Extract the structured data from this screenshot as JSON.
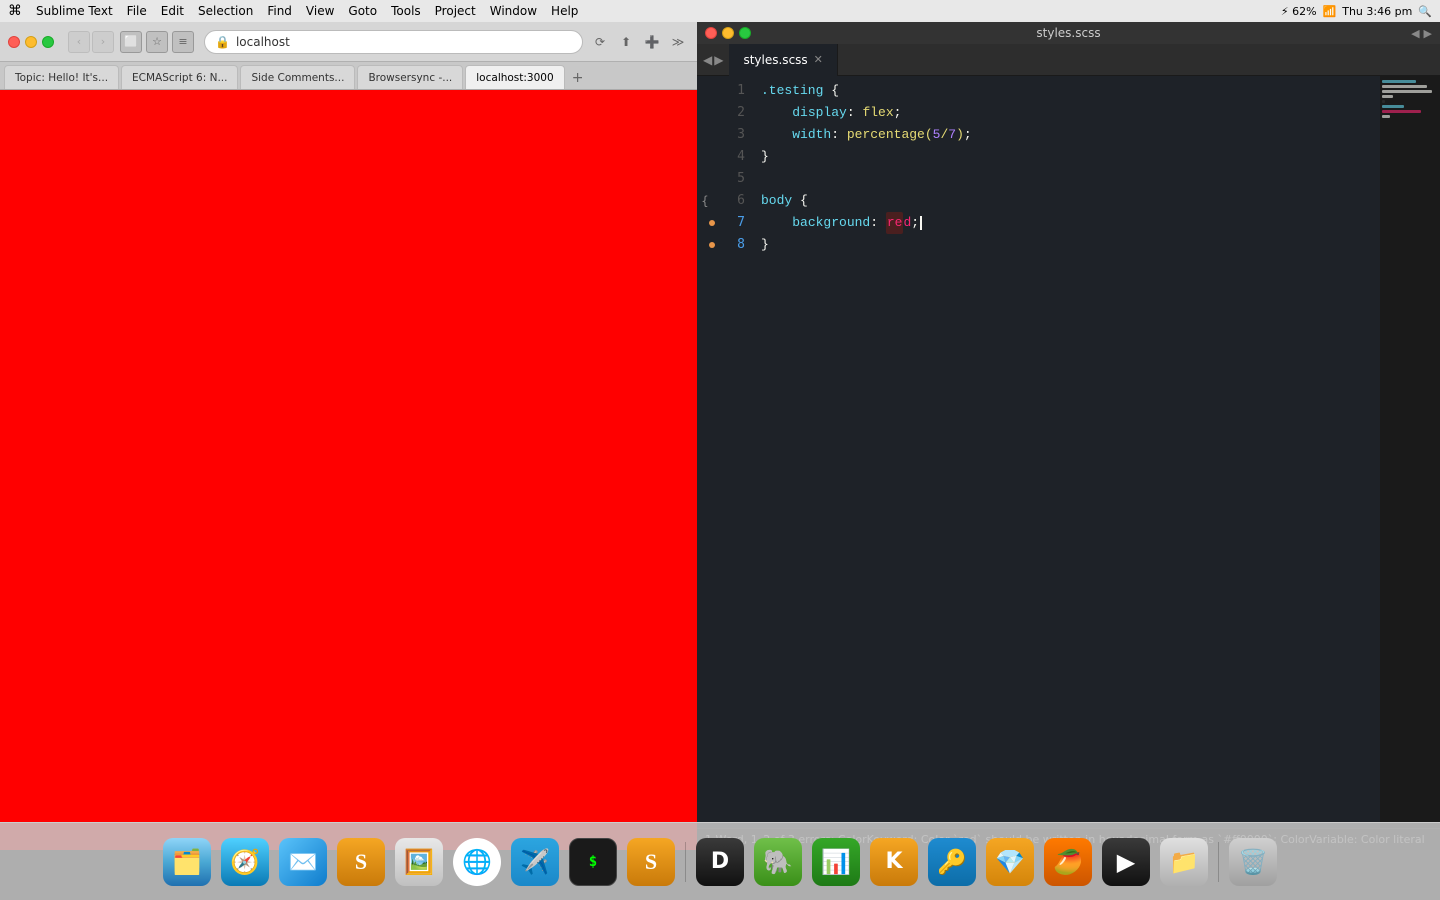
{
  "menubar": {
    "apple": "⌘",
    "app_name": "Sublime Text",
    "menus": [
      "File",
      "Edit",
      "Selection",
      "Find",
      "View",
      "Goto",
      "Tools",
      "Project",
      "Window",
      "Help"
    ],
    "right_items": [
      "62% ⚡",
      "Thu 3:46 pm"
    ],
    "selection_label": "Selection"
  },
  "browser": {
    "url": "localhost",
    "tabs": [
      {
        "label": "Topic: Hello! It's...",
        "active": false
      },
      {
        "label": "ECMAScript 6: N...",
        "active": false
      },
      {
        "label": "Side Comments...",
        "active": false
      },
      {
        "label": "Browsersync -...",
        "active": false
      },
      {
        "label": "localhost:3000",
        "active": true
      }
    ]
  },
  "editor": {
    "title": "styles.scss",
    "tab_name": "styles.scss",
    "statusbar": "1 Word, 1–2 of 3 errors: ColorKeyword: Color `red` should be written in hexadecimal form as `#ff0000`; ColorVariable: Color literal",
    "lines": [
      {
        "num": 1,
        "content": ".testing {",
        "modified": false
      },
      {
        "num": 2,
        "content": "    display: flex;",
        "modified": false
      },
      {
        "num": 3,
        "content": "    width: percentage(5/7);",
        "modified": false
      },
      {
        "num": 4,
        "content": "}",
        "modified": false
      },
      {
        "num": 5,
        "content": "",
        "modified": false
      },
      {
        "num": 6,
        "content": "body {",
        "modified": false
      },
      {
        "num": 7,
        "content": "    background: red;",
        "modified": true
      },
      {
        "num": 8,
        "content": "}",
        "modified": true
      }
    ]
  },
  "dock": {
    "items": [
      {
        "name": "Finder",
        "icon": "🗂"
      },
      {
        "name": "Safari",
        "icon": "🧭"
      },
      {
        "name": "Mail",
        "icon": "✉️"
      },
      {
        "name": "Sublime",
        "icon": "S"
      },
      {
        "name": "Preview",
        "icon": "🖼"
      },
      {
        "name": "Chrome",
        "icon": "●"
      },
      {
        "name": "Telegram",
        "icon": "✈️"
      },
      {
        "name": "Terminal",
        "icon": ">_"
      },
      {
        "name": "Sublime2",
        "icon": "S"
      },
      {
        "name": "Dash",
        "icon": "D"
      },
      {
        "name": "Evernote",
        "icon": "🐘"
      },
      {
        "name": "Numbers",
        "icon": "📊"
      },
      {
        "name": "Keka",
        "icon": "K"
      },
      {
        "name": "1Password",
        "icon": "🔑"
      },
      {
        "name": "Sketch",
        "icon": "💎"
      },
      {
        "name": "Mango",
        "icon": "🥭"
      },
      {
        "name": "QuickTime",
        "icon": "▶"
      },
      {
        "name": "Apps",
        "icon": "📁"
      },
      {
        "name": "Trash",
        "icon": "🗑"
      }
    ]
  }
}
